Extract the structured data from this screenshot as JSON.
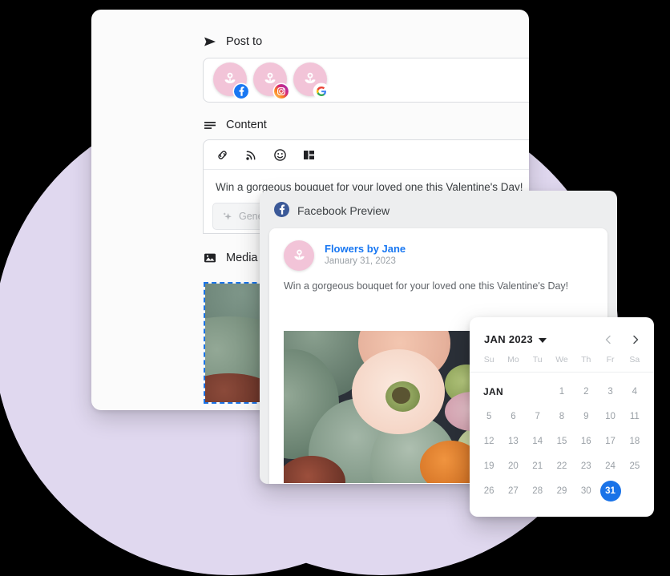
{
  "theme": {
    "background_circle": "#E0D8EF",
    "accent_blue": "#1A73E8",
    "facebook_blue": "#1877F2",
    "avatar_pink": "#F2C4D8"
  },
  "composer": {
    "post_to": {
      "label": "Post to",
      "icon": "send-icon",
      "accounts": [
        {
          "name": "flowers-by-jane-facebook",
          "network": "facebook",
          "badge_icon": "facebook-icon"
        },
        {
          "name": "flowers-by-jane-instagram",
          "network": "instagram",
          "badge_icon": "instagram-icon"
        },
        {
          "name": "flowers-by-jane-google",
          "network": "google",
          "badge_icon": "google-icon"
        }
      ],
      "dropdown_icon": "chevron-down-icon"
    },
    "content": {
      "label": "Content",
      "icon": "text-lines-icon",
      "text": "Win a gorgeous bouquet for your loved one this Valentine's Day!",
      "toolbar": [
        {
          "name": "link-button",
          "icon": "link-icon"
        },
        {
          "name": "rss-button",
          "icon": "rss-icon"
        },
        {
          "name": "emoji-button",
          "icon": "emoji-icon"
        },
        {
          "name": "template-button",
          "icon": "layout-icon"
        }
      ],
      "generate": {
        "label": "Generate text",
        "icon": "sparkle-icon",
        "dropdown_icon": "caret-down-icon",
        "disabled": true
      }
    },
    "media": {
      "label": "Media",
      "icon": "image-icon",
      "image_alt": "Flower bouquet with eucalyptus, cream ranunculus and peach roses"
    }
  },
  "facebook_preview": {
    "header_label": "Facebook Preview",
    "header_icon": "facebook-icon",
    "post": {
      "author": "Flowers by Jane",
      "date": "January 31, 2023",
      "text": "Win a gorgeous bouquet for your loved one this Valentine's Day!",
      "image_alt": "Flower bouquet with eucalyptus, cream ranunculus, peach roses and blue berries"
    }
  },
  "calendar": {
    "title": "JAN 2023",
    "title_dropdown_icon": "caret-down-icon",
    "prev_icon": "chevron-left-icon",
    "next_icon": "chevron-right-icon",
    "weekdays": [
      "Su",
      "Mo",
      "Tu",
      "We",
      "Th",
      "Fr",
      "Sa"
    ],
    "month_label": "JAN",
    "selected_day": 31,
    "weeks": [
      [
        null,
        null,
        null,
        1,
        2,
        3,
        4
      ],
      [
        5,
        6,
        7,
        8,
        9,
        10,
        11
      ],
      [
        12,
        13,
        14,
        15,
        16,
        17,
        18
      ],
      [
        19,
        20,
        21,
        22,
        23,
        24,
        25
      ],
      [
        26,
        27,
        28,
        29,
        30,
        31,
        null
      ]
    ]
  }
}
